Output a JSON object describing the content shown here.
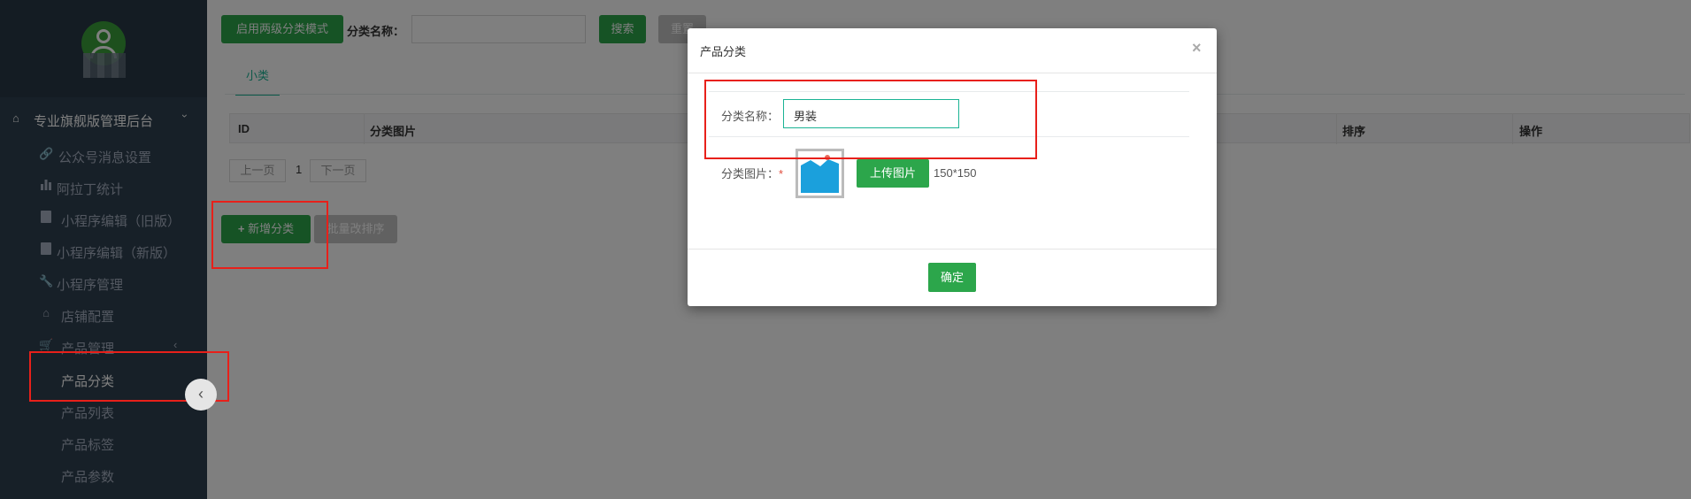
{
  "sidebar": {
    "root_label": "专业旗舰版管理后台",
    "items": [
      {
        "label": "公众号消息设置",
        "icon": "link-icon"
      },
      {
        "label": "阿拉丁统计",
        "icon": "bar-chart-icon"
      },
      {
        "label": "小程序编辑（旧版）",
        "icon": "file-icon"
      },
      {
        "label": "小程序编辑（新版）",
        "icon": "file-icon"
      },
      {
        "label": "小程序管理",
        "icon": "wrench-icon"
      },
      {
        "label": "店铺配置",
        "icon": "home-icon"
      },
      {
        "label": "产品管理",
        "icon": "cart-icon"
      }
    ],
    "sub_items": [
      {
        "label": "产品分类",
        "active": true
      },
      {
        "label": "产品列表",
        "active": false
      },
      {
        "label": "产品标签",
        "active": false
      },
      {
        "label": "产品参数",
        "active": false
      }
    ]
  },
  "toolbar": {
    "two_level_button": "启用两级分类模式",
    "name_label": "分类名称：",
    "search_button": "搜索",
    "reset_button": "重置"
  },
  "tabs": [
    "小类"
  ],
  "table": {
    "columns": [
      "ID",
      "分类图片",
      "排序",
      "操作"
    ]
  },
  "pager": {
    "prev": "上一页",
    "page": "1",
    "next": "下一页"
  },
  "actions": {
    "add_button": "新增分类",
    "batch_sort_button": "批量改排序"
  },
  "modal": {
    "title": "产品分类",
    "close": "×",
    "name_label": "分类名称：",
    "name_value": "男装",
    "image_label": "分类图片：",
    "required_mark": "*",
    "upload_button": "上传图片",
    "size_hint": "150*150",
    "confirm_button": "确定"
  },
  "colors": {
    "sidebar_bg": "#2f4050",
    "accent_green": "#2ca64b",
    "tab_color": "#1ab394",
    "highlight_red": "#e8201a"
  }
}
